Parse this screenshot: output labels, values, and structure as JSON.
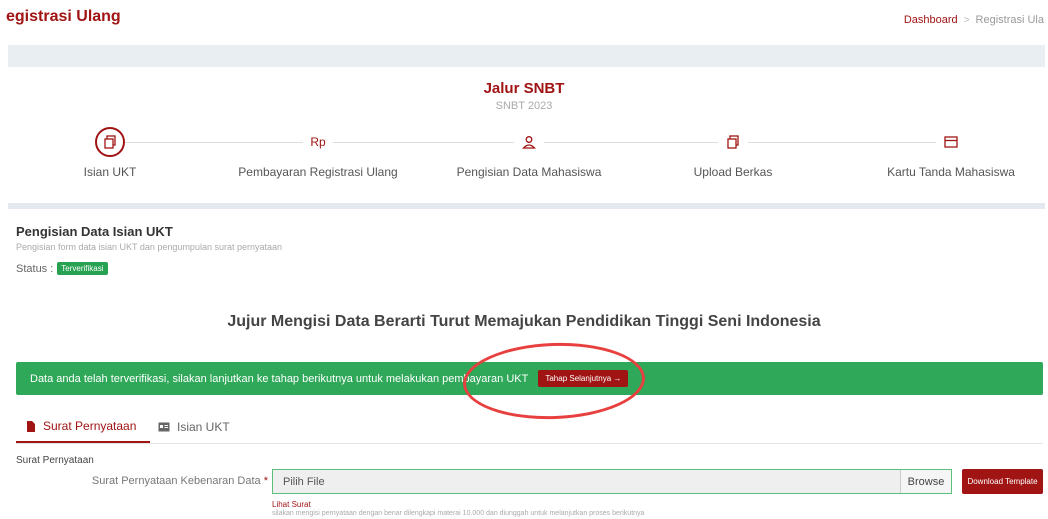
{
  "header": {
    "page_title": "egistrasi Ulang",
    "breadcrumb": {
      "home": "Dashboard",
      "separator": ">",
      "current": "Registrasi Ula"
    }
  },
  "jalur": {
    "title": "Jalur SNBT",
    "subtitle": "SNBT 2023"
  },
  "steps": [
    {
      "label": "Isian UKT",
      "icon": "document-icon",
      "active": true
    },
    {
      "label": "Pembayaran Registrasi Ulang",
      "icon_text": "Rp",
      "active": false
    },
    {
      "label": "Pengisian Data Mahasiswa",
      "icon": "user-icon",
      "active": false
    },
    {
      "label": "Upload Berkas",
      "icon": "document-icon",
      "active": false
    },
    {
      "label": "Kartu Tanda Mahasiswa",
      "icon": "card-icon",
      "active": false
    }
  ],
  "section": {
    "title": "Pengisian Data Isian UKT",
    "subtitle": "Pengisian form data isian UKT dan pengumpulan surat pernyataan",
    "status_label": "Status :",
    "status_badge": "Terverifikasi"
  },
  "motto": "Jujur Mengisi Data Berarti Turut Memajukan Pendidikan Tinggi Seni Indonesia",
  "alert": {
    "text": "Data anda telah terverifikasi, silakan lanjutkan ke tahap berikutnya untuk melakukan pembayaran UKT",
    "button": "Tahap Selanjutnya →"
  },
  "tabs": [
    {
      "label": "Surat Pernyataan",
      "icon": "file-icon",
      "active": true
    },
    {
      "label": "Isian UKT",
      "icon": "id-card-icon",
      "active": false
    }
  ],
  "form": {
    "group_title": "Surat Pernyataan",
    "field_label": "Surat Pernyataan Kebenaran Data",
    "required_mark": "*",
    "file_placeholder": "Pilih File",
    "browse_label": "Browse",
    "download_button": "Download Template",
    "view_link": "Lihat Surat",
    "help_text": "silakan mengisi pernyataan dengan benar dilengkapi materai 10.000 dan diunggah untuk melanjutkan proses berikutnya"
  },
  "colors": {
    "primary": "#a01414",
    "success": "#2fa85a",
    "annotation": "#e8403f"
  }
}
